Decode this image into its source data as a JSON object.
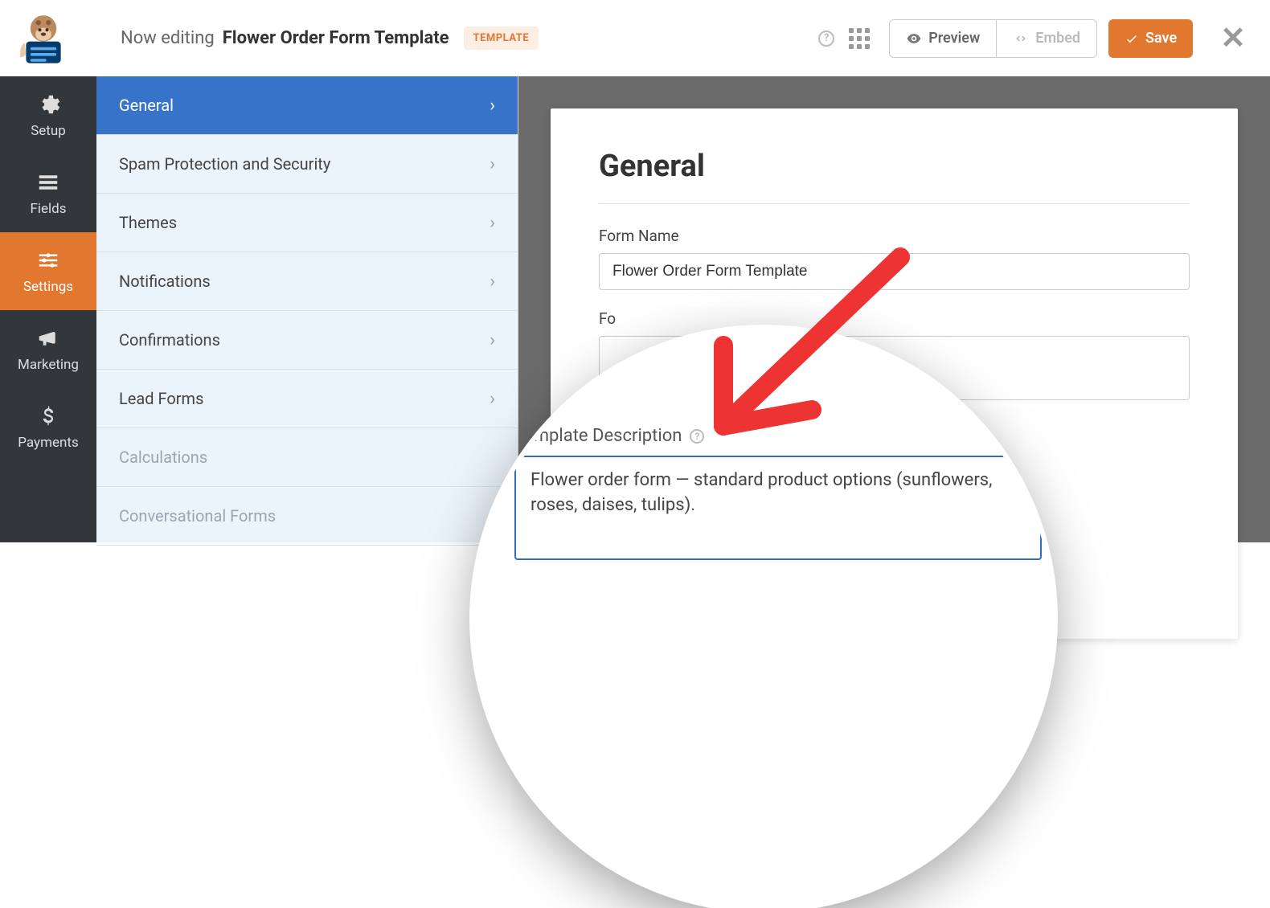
{
  "header": {
    "now_editing": "Now editing",
    "form_title": "Flower Order Form Template",
    "template_badge": "TEMPLATE",
    "preview": "Preview",
    "embed": "Embed",
    "save": "Save"
  },
  "rail": [
    {
      "id": "setup",
      "label": "Setup"
    },
    {
      "id": "fields",
      "label": "Fields"
    },
    {
      "id": "settings",
      "label": "Settings"
    },
    {
      "id": "marketing",
      "label": "Marketing"
    },
    {
      "id": "payments",
      "label": "Payments"
    }
  ],
  "panel": [
    {
      "label": "General",
      "selected": true
    },
    {
      "label": "Spam Protection and Security"
    },
    {
      "label": "Themes"
    },
    {
      "label": "Notifications"
    },
    {
      "label": "Confirmations"
    },
    {
      "label": "Lead Forms"
    },
    {
      "label": "Calculations",
      "muted": true
    },
    {
      "label": "Conversational Forms",
      "muted": true
    }
  ],
  "form": {
    "heading": "General",
    "name_label": "Form Name",
    "name_value": "Flower Order Form Template",
    "desc_label_short": "Fo",
    "template_desc_label": "Template Description",
    "template_desc_value": "Flower order form — standard product options (sunflowers, roses, daises, tulips)."
  }
}
